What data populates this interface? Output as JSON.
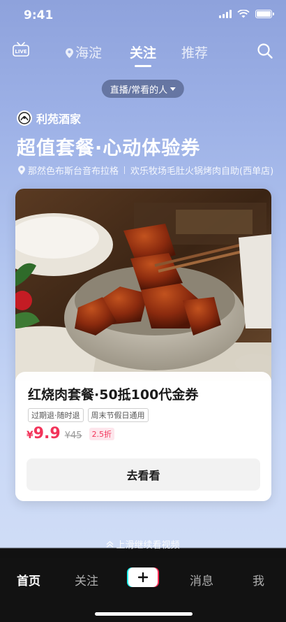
{
  "status_bar": {
    "time": "9:41"
  },
  "top_nav": {
    "live_icon": "live-tv-icon",
    "tabs": [
      {
        "label": "海淀",
        "icon": "location-pin-icon"
      },
      {
        "label": "关注",
        "active": true
      },
      {
        "label": "推荐"
      }
    ],
    "search_icon": "search-icon"
  },
  "filter_chip": {
    "label": "直播/常看的人",
    "icon": "caret-down-icon"
  },
  "merchant": {
    "name": "利苑酒家"
  },
  "headline": "超值套餐·心动体验券",
  "locations": {
    "first": "那然色布斯台音布拉格",
    "second": "欢乐牧场毛肚火锅烤肉自助(西单店)"
  },
  "deal": {
    "title": "红烧肉套餐·50抵100代金券",
    "tags": [
      "过期退·随时退",
      "周末节假日通用"
    ],
    "price_symbol": "¥",
    "price": "9.9",
    "original_price": "¥45",
    "discount": "2.5折",
    "cta": "去看看"
  },
  "swipe_hint": "上滑继续看视频",
  "bottom_tabs": {
    "home": "首页",
    "follow": "关注",
    "create_icon": "plus-icon",
    "messages": "消息",
    "me": "我"
  },
  "colors": {
    "price_red": "#f2345a",
    "tabbar_bg": "#121212",
    "accent_cyan": "#25f4ee",
    "accent_pink": "#fe2c55"
  }
}
